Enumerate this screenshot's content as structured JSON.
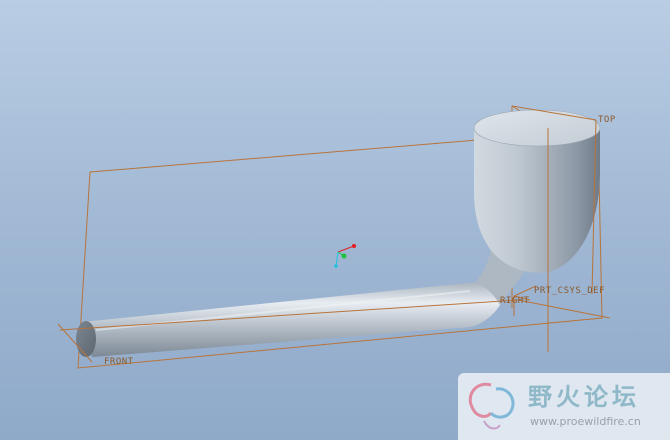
{
  "viewport": {
    "datum_planes": {
      "top": "TOP",
      "front": "FRONT",
      "right": "RIGHT"
    },
    "csys_label": "PRT_CSYS_DEF"
  },
  "watermark": {
    "title": "野火论坛",
    "url": "www.proewildfire.cn"
  },
  "colors": {
    "datum_plane": "#b8743a",
    "datum_text": "#8a5a2c",
    "background_top": "#b9cde4",
    "background_bottom": "#8fa9c9",
    "part_surface": "#b7c1cb",
    "watermark_title": "#8fb8c8",
    "watermark_url": "#9aa0a8",
    "csys_x": "#e02020",
    "csys_y": "#20c040",
    "csys_z": "#20c0e0"
  },
  "icons": {
    "csys": "coordinate-system-triad",
    "logo": "butterfly-logo"
  }
}
